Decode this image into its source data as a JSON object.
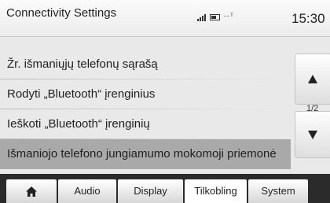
{
  "header": {
    "title": "Connectivity Settings",
    "status_icons": [
      "signal-icon",
      "battery-icon"
    ],
    "network_indicator": "--ᵀ",
    "clock": "15:30"
  },
  "list": {
    "items": [
      {
        "label": "Žr. išmaniųjų telefonų sąrašą",
        "selected": false
      },
      {
        "label": "Rodyti „Bluetooth“ įrenginius",
        "selected": false
      },
      {
        "label": "Ieškoti „Bluetooth“ įrenginių",
        "selected": false
      },
      {
        "label": "Išmaniojo telefono jungiamumo mokomoji priemonė",
        "selected": true
      }
    ]
  },
  "scroll": {
    "page_indicator": "1/2",
    "up_icon": "triangle-up-icon",
    "down_icon": "triangle-down-icon"
  },
  "tabs": [
    {
      "label": "",
      "icon": "home-icon",
      "active": false
    },
    {
      "label": "Audio",
      "active": false
    },
    {
      "label": "Display",
      "active": false
    },
    {
      "label": "Tilkobling",
      "active": true
    },
    {
      "label": "System",
      "active": false
    }
  ],
  "colors": {
    "selected_row": "#a9a9a9",
    "tabbar_background": "#2b2b2b",
    "screen_background": "#e9e9e9"
  }
}
